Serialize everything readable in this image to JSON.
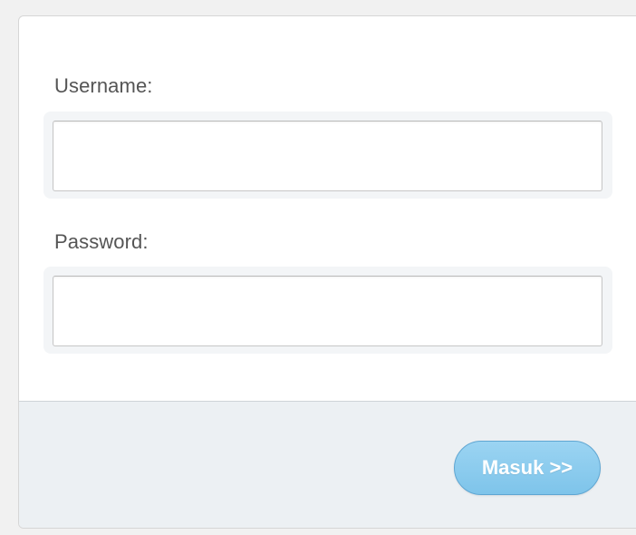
{
  "form": {
    "username_label": "Username:",
    "username_value": "",
    "password_label": "Password:",
    "password_value": "",
    "submit_label": "Masuk >>"
  },
  "colors": {
    "panel_background": "#ffffff",
    "footer_background": "#ecf0f3",
    "button_background": "#8fcdef",
    "button_text": "#ffffff",
    "label_text": "#555555"
  }
}
